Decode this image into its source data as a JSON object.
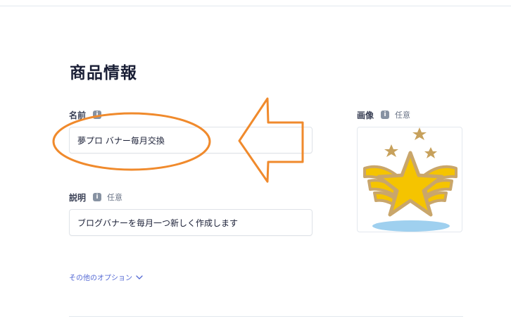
{
  "section_title": "商品情報",
  "name_field": {
    "label": "名前",
    "info_icon": "info-icon",
    "value": "夢プロ バナー毎月交換"
  },
  "description_field": {
    "label": "説明",
    "info_icon": "info-icon",
    "optional_label": "任意",
    "value": "ブログバナーを毎月一つ新しく作成します"
  },
  "image_field": {
    "label": "画像",
    "info_icon": "info-icon",
    "optional_label": "任意",
    "image_content": "winged-star-illustration"
  },
  "more_options": {
    "label": "その他のオプション",
    "icon": "chevron-down-icon"
  },
  "annotations": {
    "color": "#f08a2c",
    "shapes": [
      "ellipse-highlight",
      "left-arrow"
    ]
  },
  "colors": {
    "link": "#5469d4",
    "star_fill": "#f5c400",
    "star_outline": "#c9a66b",
    "small_star": "#c7a15c",
    "shadow": "#9fd0ef"
  }
}
